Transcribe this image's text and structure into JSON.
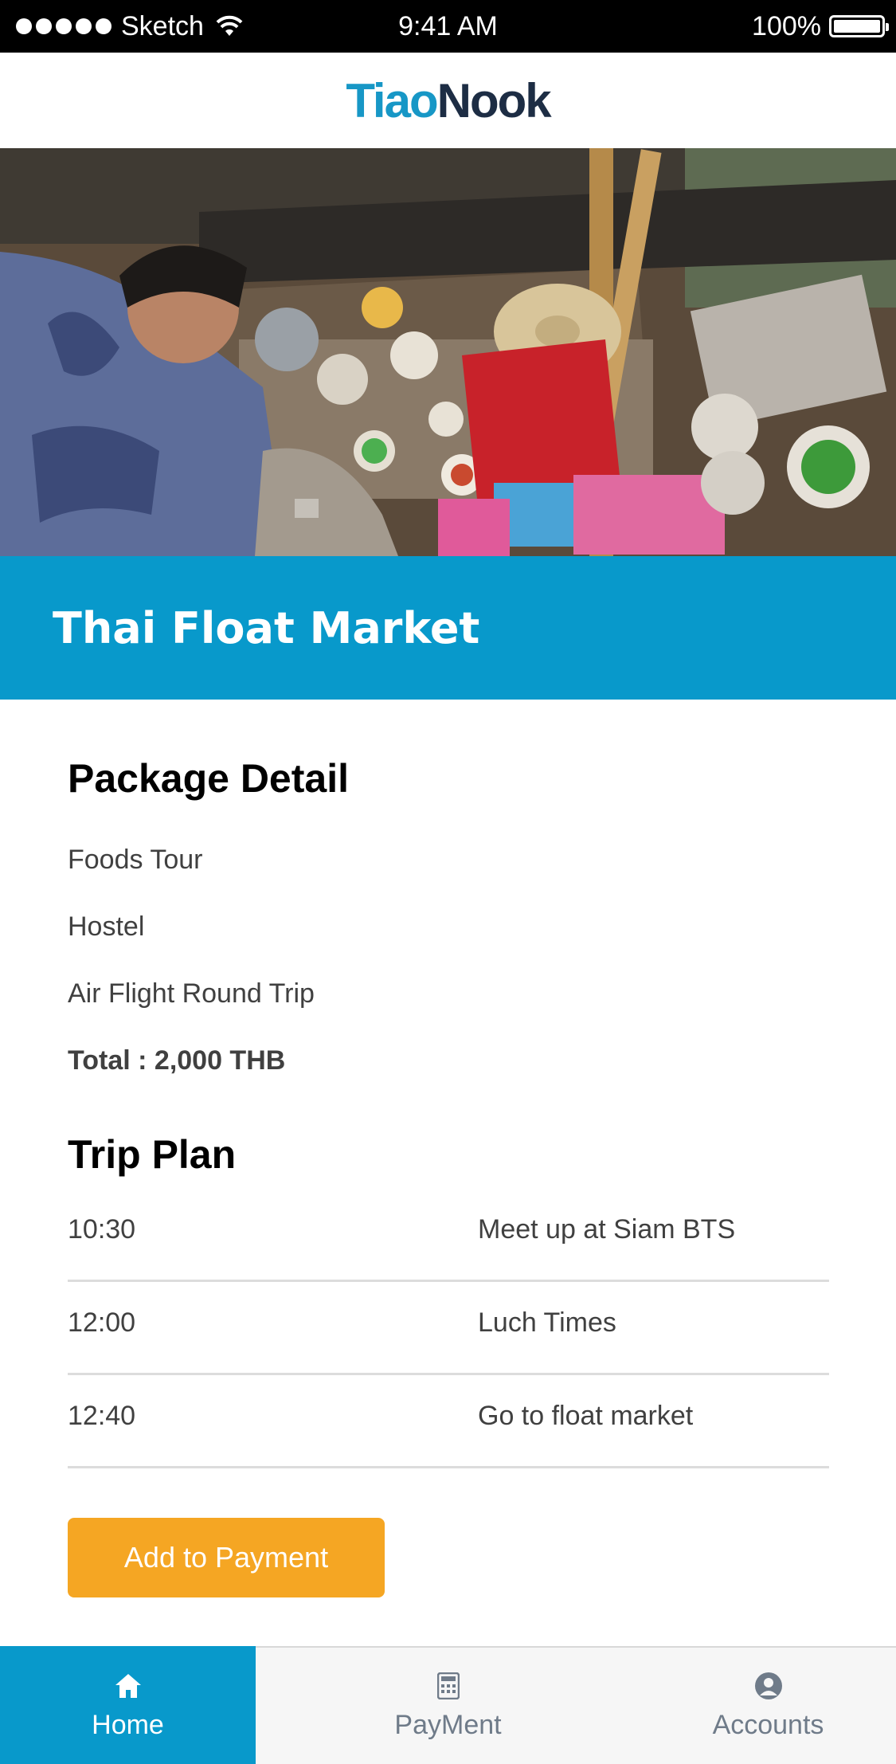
{
  "status_bar": {
    "carrier": "Sketch",
    "time": "9:41 AM",
    "battery": "100%"
  },
  "header": {
    "logo_part1": "Tiao",
    "logo_part2": "Nook"
  },
  "hero": {
    "title": "Thai Float Market"
  },
  "package": {
    "heading": "Package Detail",
    "items": [
      "Foods Tour",
      "Hostel",
      "Air Flight Round Trip"
    ],
    "total": "Total : 2,000 THB"
  },
  "trip_plan": {
    "heading": "Trip Plan",
    "rows": [
      {
        "time": "10:30",
        "activity": "Meet up at Siam BTS"
      },
      {
        "time": "12:00",
        "activity": "Luch Times"
      },
      {
        "time": "12:40",
        "activity": "Go to float market"
      }
    ]
  },
  "actions": {
    "add_to_payment": "Add to Payment"
  },
  "tabs": [
    {
      "label": "Home",
      "icon": "home-icon",
      "active": true
    },
    {
      "label": "PayMent",
      "icon": "calculator-icon",
      "active": false
    },
    {
      "label": "Accounts",
      "icon": "user-icon",
      "active": false
    }
  ],
  "colors": {
    "brand_blue": "#0899cb",
    "logo_dark": "#1d2d44",
    "button_orange": "#f5a623"
  }
}
